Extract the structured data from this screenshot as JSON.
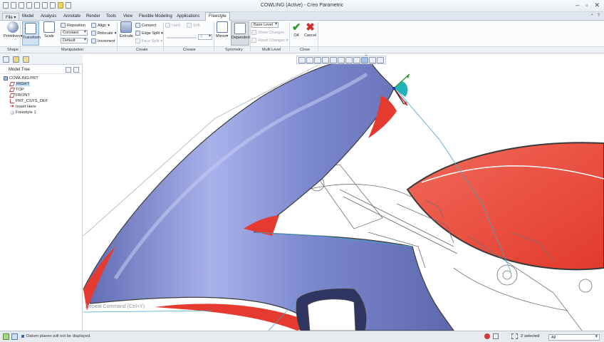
{
  "window": {
    "title": "COWLING (Active) - Creo Parametric"
  },
  "tabs": [
    {
      "label": "File"
    },
    {
      "label": "Model"
    },
    {
      "label": "Analysis"
    },
    {
      "label": "Annotate"
    },
    {
      "label": "Render"
    },
    {
      "label": "Tools"
    },
    {
      "label": "View"
    },
    {
      "label": "Flexible Modeling"
    },
    {
      "label": "Applications"
    },
    {
      "label": "Freestyle"
    }
  ],
  "ribbon": {
    "shape": {
      "primitives": "Primitives",
      "group": "Shape"
    },
    "manipulation": {
      "transform": "Transform",
      "scale": "Scale",
      "reposition": "Reposition",
      "constant": "Constant",
      "default": "Default",
      "align": "Align",
      "relocate": "Relocate",
      "increment": "Increment",
      "group": "Manipulation"
    },
    "create": {
      "extrude": "Extrude",
      "connect": "Connect",
      "edge_split": "Edge Split",
      "face_split": "Face Split",
      "group": "Create"
    },
    "crease": {
      "hard": "Hard",
      "soft": "Soft",
      "value": "0",
      "group": "Crease"
    },
    "symmetry": {
      "mirror": "Mirror",
      "dependent": "Dependent",
      "group": "Symmetry"
    },
    "multi_level": {
      "base_level": "Base Level",
      "show_changes": "Show Changes",
      "reset_changes": "Reset Changes",
      "group": "Multi Level"
    },
    "close": {
      "ok": "OK",
      "cancel": "Cancel",
      "group": "Close"
    }
  },
  "tree": {
    "header": "Model Tree",
    "items": [
      {
        "label": "COWLING.PRT"
      },
      {
        "label": "RIGHT"
      },
      {
        "label": "TOP"
      },
      {
        "label": "FRONT"
      },
      {
        "label": "PRT_CSYS_DEF"
      },
      {
        "label": "Insert Here"
      },
      {
        "label": "Freestyle 1"
      }
    ]
  },
  "viewport": {
    "repeat_hint": "Repeat Command (Ctrl+Y)"
  },
  "status": {
    "message": "Datum planes will not be displayed.",
    "selected": "2 selected",
    "filter": "All"
  },
  "colors": {
    "surface": "#7b86c8",
    "highlight": "#e53a2f",
    "ribbon_active": "#ffffff",
    "ok_green": "#2f9a2f",
    "cancel_red": "#d12b2b"
  }
}
